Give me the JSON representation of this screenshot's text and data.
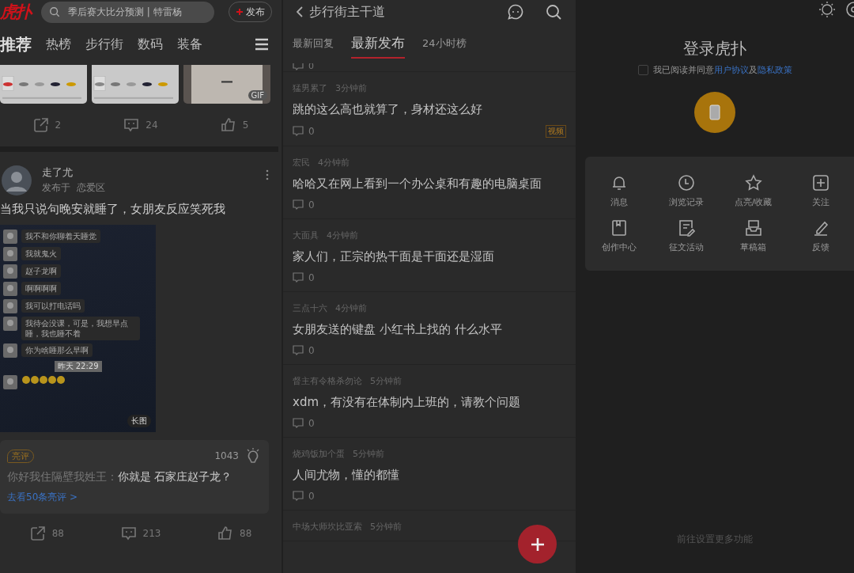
{
  "left": {
    "logo": "虎扑",
    "search": {
      "placeholder": "季后赛大比分预测 | 特雷杨"
    },
    "publish_button": "发布",
    "tabs": [
      {
        "label": "推荐",
        "selected": true
      },
      {
        "label": "热榜",
        "selected": false
      },
      {
        "label": "步行街",
        "selected": false
      },
      {
        "label": "数码",
        "selected": false
      },
      {
        "label": "装备",
        "selected": false
      }
    ],
    "thumbnails": [
      {
        "kind": "picture"
      },
      {
        "kind": "picture"
      },
      {
        "kind": "picture",
        "badge": "GIF"
      }
    ],
    "top_actions": {
      "shares": "2",
      "comments": "24",
      "likes": "5"
    },
    "post": {
      "author": "走了尤",
      "posted_in": "发布于",
      "section": "恋爱区",
      "title": "当我只说句晚安就睡了，女朋友反应笑死我",
      "chat": [
        "我不和你聊着天睡觉",
        "我就鬼火",
        "赵子龙啊",
        "啊啊啊啊",
        "我可以打电话吗",
        "我待会没课，可是，我想早点睡，我也睡不着",
        "你为啥睡那么早啊"
      ],
      "chat_time": "昨天 22:29",
      "image_badge": "长图",
      "comment": {
        "badge": "亮评",
        "count": "1043",
        "author": "你好我住隔壁我姓王：",
        "text": "你就是 石家庄赵子龙？",
        "link": "去看50条亮评 >"
      },
      "actions": {
        "shares": "88",
        "comments": "213",
        "likes": "88"
      }
    }
  },
  "middle": {
    "title": "步行街主干道",
    "tabs": [
      {
        "label": "最新回复",
        "selected": false
      },
      {
        "label": "最新发布",
        "selected": true
      },
      {
        "label": "24小时榜",
        "selected": false
      }
    ],
    "cut_reply_count": "0",
    "posts": [
      {
        "author": "猛男累了",
        "time": "3分钟前",
        "title": "跳的这么高也就算了，身材还这么好",
        "replies": "0",
        "tag": "视频"
      },
      {
        "author": "宏民",
        "time": "4分钟前",
        "title": "哈哈又在网上看到一个办公桌和有趣的电脑桌面",
        "replies": "0"
      },
      {
        "author": "大面具",
        "time": "4分钟前",
        "title": "家人们，正宗的热干面是干面还是湿面",
        "replies": "0"
      },
      {
        "author": "三点十六",
        "time": "4分钟前",
        "title": "女朋友送的键盘 小红书上找的 什么水平",
        "replies": "0"
      },
      {
        "author": "督主有令格杀勿论",
        "time": "5分钟前",
        "title": "xdm，有没有在体制内上班的，请教个问题",
        "replies": "0"
      },
      {
        "author": "烧鸡饭加个蛋",
        "time": "5分钟前",
        "title": "人间尤物，懂的都懂",
        "replies": "0"
      },
      {
        "author": "中场大师坎比亚索",
        "time": "5分钟前"
      }
    ]
  },
  "right": {
    "title": "登录虎扑",
    "agree": {
      "checked": false,
      "parts": [
        {
          "text": "我已阅读并同意",
          "link": false
        },
        {
          "text": "用户协议",
          "link": true
        },
        {
          "text": "及",
          "link": false
        },
        {
          "text": "隐私政策",
          "link": true
        }
      ]
    },
    "menu": [
      {
        "kind": "bell",
        "label": "消息"
      },
      {
        "kind": "clock",
        "label": "浏览记录"
      },
      {
        "kind": "star",
        "label": "点亮/收藏"
      },
      {
        "kind": "plus",
        "label": "关注"
      },
      {
        "kind": "book",
        "label": "创作中心"
      },
      {
        "kind": "note",
        "label": "征文活动"
      },
      {
        "kind": "tray",
        "label": "草稿箱"
      },
      {
        "kind": "pen",
        "label": "反馈"
      }
    ],
    "footer": "前往设置更多功能"
  }
}
